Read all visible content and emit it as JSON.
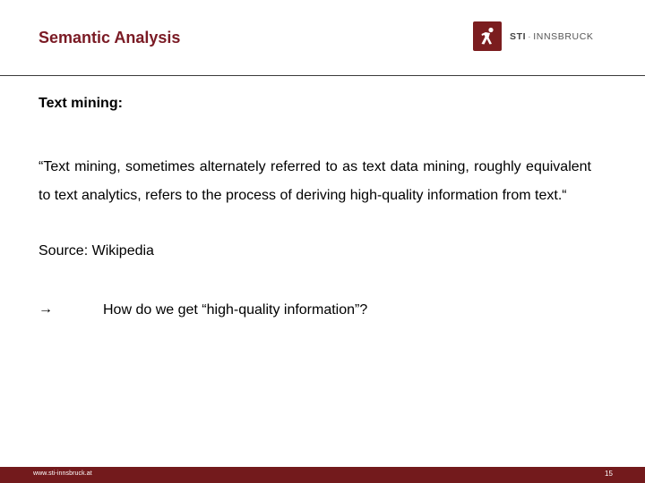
{
  "header": {
    "title": "Semantic Analysis",
    "logo": {
      "icon": "running-figure-icon",
      "brand_bold": "STI",
      "separator": "·",
      "brand_rest": "INNSBRUCK",
      "mark_color": "#7b1d1f"
    }
  },
  "content": {
    "heading": "Text mining:",
    "quote": "“Text mining, sometimes alternately referred to as text data mining, roughly equivalent to text analytics, refers to the process of deriving high-quality information from text.“",
    "source": "Source: Wikipedia",
    "bullet": {
      "icon": "→",
      "text": "How do we get “high-quality information”?"
    }
  },
  "footer": {
    "url": "www.sti-innsbruck.at",
    "page_number": "15",
    "color": "#731a1c"
  },
  "theme": {
    "title_color": "#7a1a24"
  }
}
